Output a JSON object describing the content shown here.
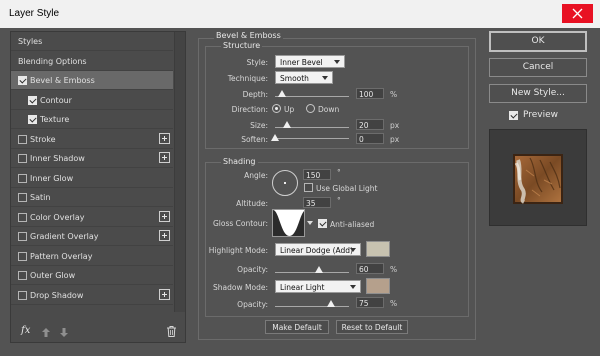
{
  "window": {
    "title": "Layer Style"
  },
  "left_panel": {
    "items": [
      {
        "label": "Styles",
        "checkbox": null,
        "checked": false,
        "add": false,
        "active": false,
        "sub": false
      },
      {
        "label": "Blending Options",
        "checkbox": null,
        "checked": false,
        "add": false,
        "active": false,
        "sub": false
      },
      {
        "label": "Bevel & Emboss",
        "checkbox": true,
        "checked": true,
        "add": false,
        "active": true,
        "sub": false
      },
      {
        "label": "Contour",
        "checkbox": true,
        "checked": true,
        "add": false,
        "active": false,
        "sub": true
      },
      {
        "label": "Texture",
        "checkbox": true,
        "checked": true,
        "add": false,
        "active": false,
        "sub": true
      },
      {
        "label": "Stroke",
        "checkbox": true,
        "checked": false,
        "add": true,
        "active": false,
        "sub": false
      },
      {
        "label": "Inner Shadow",
        "checkbox": true,
        "checked": false,
        "add": true,
        "active": false,
        "sub": false
      },
      {
        "label": "Inner Glow",
        "checkbox": true,
        "checked": false,
        "add": false,
        "active": false,
        "sub": false
      },
      {
        "label": "Satin",
        "checkbox": true,
        "checked": false,
        "add": false,
        "active": false,
        "sub": false
      },
      {
        "label": "Color Overlay",
        "checkbox": true,
        "checked": false,
        "add": true,
        "active": false,
        "sub": false
      },
      {
        "label": "Gradient Overlay",
        "checkbox": true,
        "checked": false,
        "add": true,
        "active": false,
        "sub": false
      },
      {
        "label": "Pattern Overlay",
        "checkbox": true,
        "checked": false,
        "add": false,
        "active": false,
        "sub": false
      },
      {
        "label": "Outer Glow",
        "checkbox": true,
        "checked": false,
        "add": false,
        "active": false,
        "sub": false
      },
      {
        "label": "Drop Shadow",
        "checkbox": true,
        "checked": false,
        "add": true,
        "active": false,
        "sub": false
      }
    ],
    "fx_label": "fx"
  },
  "bevel": {
    "heading": "Bevel & Emboss",
    "structure": {
      "heading": "Structure",
      "style_label": "Style:",
      "style_value": "Inner Bevel",
      "technique_label": "Technique:",
      "technique_value": "Smooth",
      "depth_label": "Depth:",
      "depth_value": "100",
      "depth_unit": "%",
      "depth_fraction": 0.1,
      "direction_label": "Direction:",
      "direction_up": "Up",
      "direction_down": "Down",
      "direction_selected": "Up",
      "size_label": "Size:",
      "size_value": "20",
      "size_unit": "px",
      "size_fraction": 0.16,
      "soften_label": "Soften:",
      "soften_value": "0",
      "soften_unit": "px",
      "soften_fraction": 0.0
    },
    "shading": {
      "heading": "Shading",
      "angle_label": "Angle:",
      "angle_value": "150",
      "angle_unit": "°",
      "use_global_light_label": "Use Global Light",
      "use_global_light_checked": false,
      "altitude_label": "Altitude:",
      "altitude_value": "35",
      "altitude_unit": "°",
      "gloss_contour_label": "Gloss Contour:",
      "anti_aliased_label": "Anti-aliased",
      "anti_aliased_checked": true,
      "highlight_mode_label": "Highlight Mode:",
      "highlight_mode_value": "Linear Dodge (Add)",
      "highlight_color": "#c7c2b0",
      "highlight_opacity_label": "Opacity:",
      "highlight_opacity_value": "60",
      "highlight_opacity_unit": "%",
      "highlight_opacity_fraction": 0.6,
      "shadow_mode_label": "Shadow Mode:",
      "shadow_mode_value": "Linear Light",
      "shadow_color": "#b5a08c",
      "shadow_opacity_label": "Opacity:",
      "shadow_opacity_value": "75",
      "shadow_opacity_unit": "%",
      "shadow_opacity_fraction": 0.75
    },
    "make_default_label": "Make Default",
    "reset_default_label": "Reset to Default"
  },
  "right": {
    "ok_label": "OK",
    "cancel_label": "Cancel",
    "new_style_label": "New Style...",
    "preview_label": "Preview",
    "preview_checked": true
  },
  "colors": {
    "dialog_bg": "#535353",
    "close_red": "#e81123"
  }
}
